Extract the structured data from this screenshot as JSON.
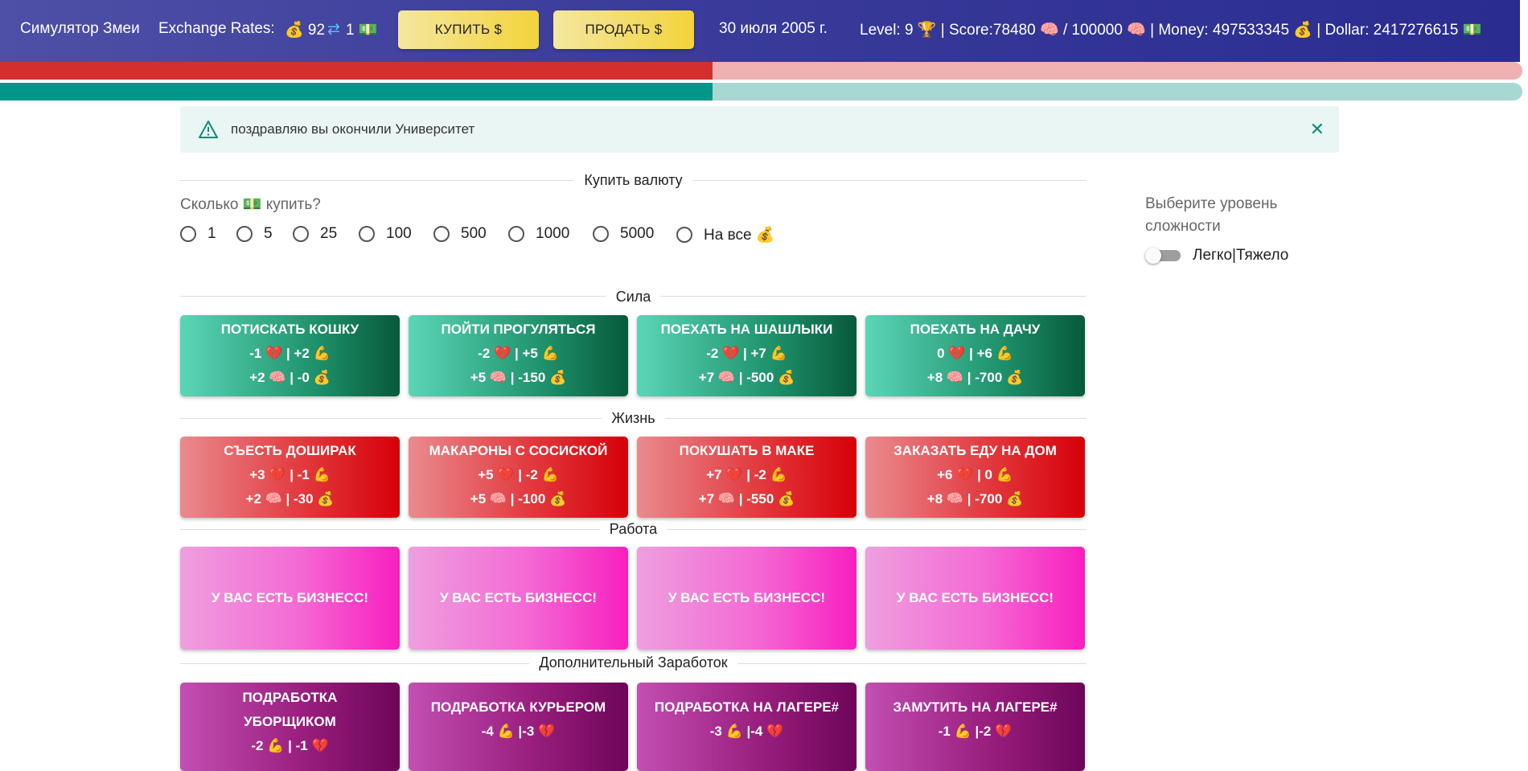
{
  "header": {
    "app_title": "Симулятор Змеи",
    "rates_label": "Exchange Rates:",
    "rate_money": "💰 92",
    "rate_arrow": "⇄",
    "rate_dollar": "1 💵",
    "buy_button": "КУПИТЬ $",
    "sell_button": "ПРОДАТЬ $",
    "date": "30 июля 2005 г.",
    "stats": "Level: 9 🏆 | Score:78480 🧠 / 100000 🧠 | Money: 497533345 💰 | Dollar: 2417276615 💵"
  },
  "bars": {
    "health": {
      "fraction": 0.468,
      "fill": "#d32f2f",
      "track": "#efb1b1"
    },
    "strength": {
      "fraction": 0.468,
      "fill": "#009688",
      "track": "#a7d8d2"
    }
  },
  "alert": {
    "message": "поздравляю вы окончили Университет",
    "close": "✕",
    "accent": "#0e8a7e"
  },
  "currency": {
    "section": "Купить валюту",
    "question": "Сколько 💵 купить?",
    "options": [
      "1",
      "5",
      "25",
      "100",
      "500",
      "1000",
      "5000",
      "На все 💰"
    ]
  },
  "difficulty": {
    "label": "Выберите уровень сложности",
    "toggle_label": "Легко|Тяжело"
  },
  "sections": [
    {
      "title": "Сила",
      "cards": [
        {
          "title": "ПОТИСКАТЬ КОШКУ",
          "l1": "-1 💔 | +2 💪",
          "l2": "+2 🧠 | -0 💰"
        },
        {
          "title": "ПОЙТИ ПРОГУЛЯТЬСЯ",
          "l1": "-2 💔 | +5 💪",
          "l2": "+5 🧠 | -150 💰"
        },
        {
          "title": "ПОЕХАТЬ НА ШАШЛЫКИ",
          "l1": "-2 💔 | +7 💪",
          "l2": "+7 🧠 | -500 💰"
        },
        {
          "title": "ПОЕХАТЬ НА ДАЧУ",
          "l1": "0 💔 | +6 💪",
          "l2": "+8 🧠 | -700 💰"
        }
      ]
    },
    {
      "title": "Жизнь",
      "cards": [
        {
          "title": "СЪЕСТЬ ДОШИРАК",
          "l1": "+3 💔 | -1 💪",
          "l2": "+2 🧠 | -30 💰"
        },
        {
          "title": "МАКАРОНЫ С СОСИСКОЙ",
          "l1": "+5 💔 | -2 💪",
          "l2": "+5 🧠 | -100 💰"
        },
        {
          "title": "ПОКУШАТЬ В МАКЕ",
          "l1": "+7 💔 | -2 💪",
          "l2": "+7 🧠 | -550 💰"
        },
        {
          "title": "ЗАКАЗАТЬ ЕДУ НА ДОМ",
          "l1": "+6 💔 | 0 💪",
          "l2": "+8 🧠 | -700 💰"
        }
      ]
    },
    {
      "title": "Работа",
      "cards": [
        {
          "title": "У ВАС ЕСТЬ БИЗНЕСС!"
        },
        {
          "title": "У ВАС ЕСТЬ БИЗНЕСС!"
        },
        {
          "title": "У ВАС ЕСТЬ БИЗНЕСС!"
        },
        {
          "title": "У ВАС ЕСТЬ БИЗНЕСС!"
        }
      ]
    },
    {
      "title": "Дополнительный Заработок",
      "cards": [
        {
          "title": "ПОДРАБОТКА УБОРЩИКОМ",
          "l1": "-2 💪 | -1 💔"
        },
        {
          "title": "ПОДРАБОТКА КУРЬЕРОМ",
          "l1": "-4 💪 |-3 💔"
        },
        {
          "title": "ПОДРАБОТКА НА ЛАГЕРЕ#",
          "l1": "-3 💪 |-4 💔"
        },
        {
          "title": "ЗАМУТИТЬ НА ЛАГЕРЕ#",
          "l1": "-1 💪 |-2 💔"
        }
      ]
    }
  ]
}
